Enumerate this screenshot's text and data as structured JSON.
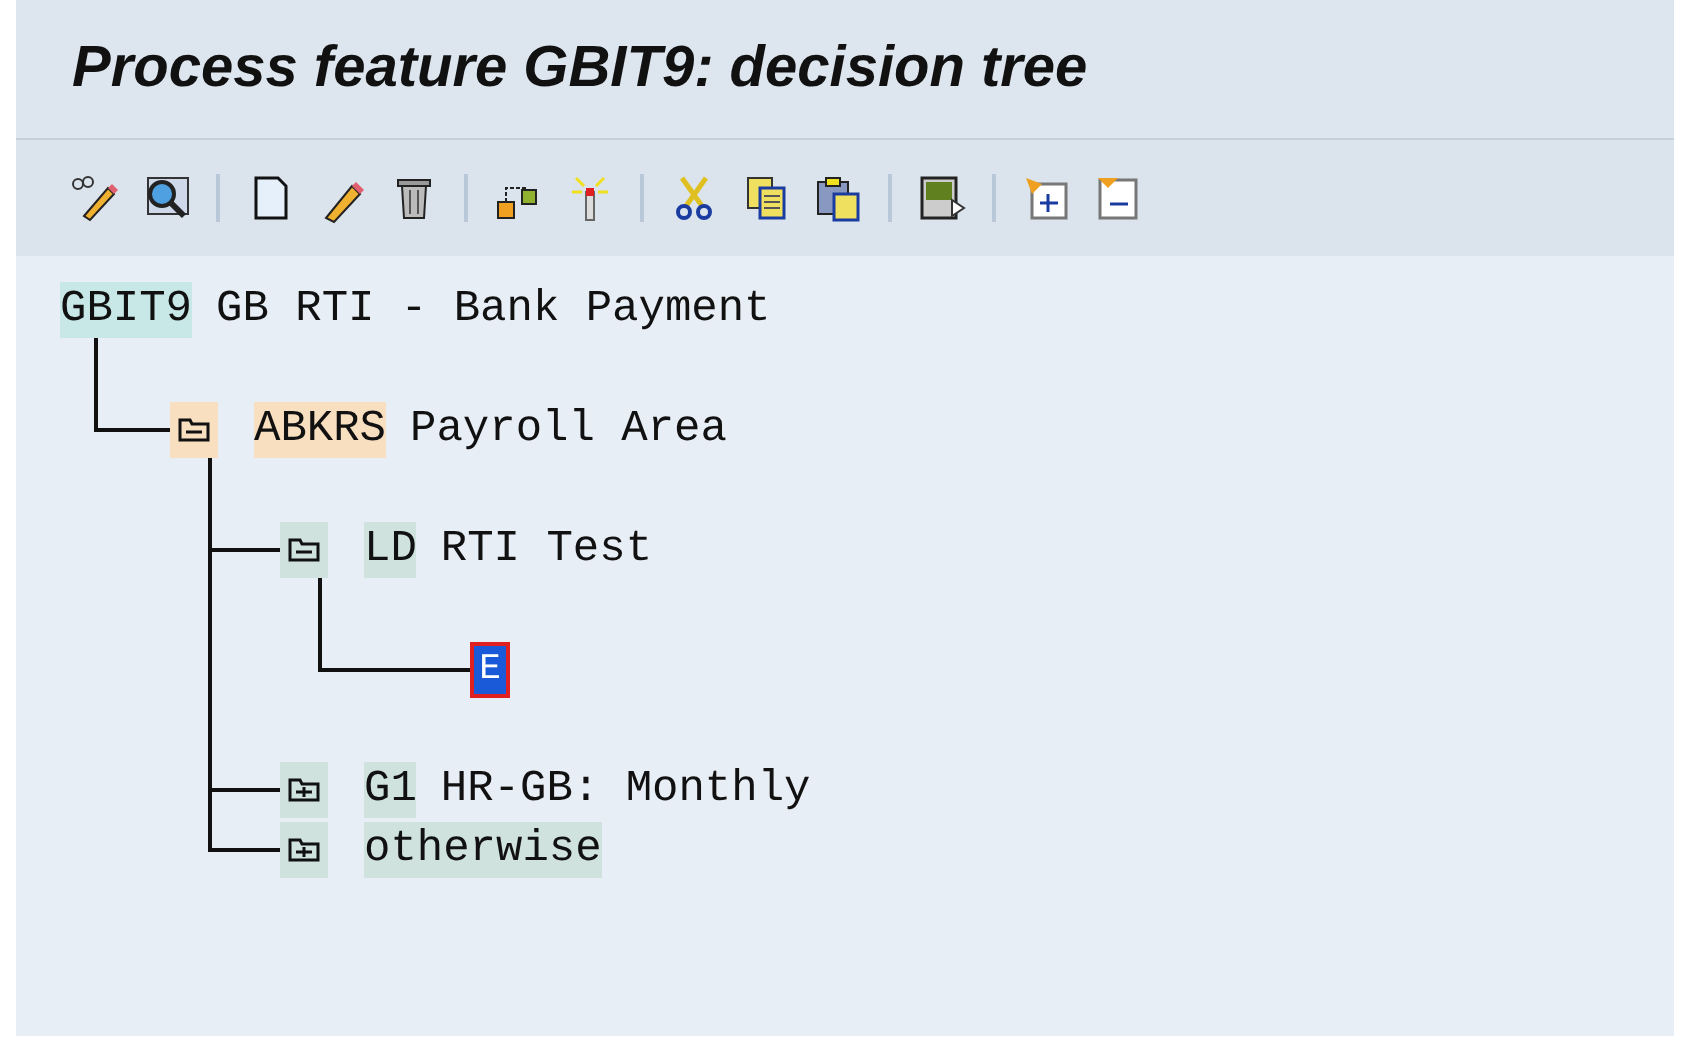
{
  "window": {
    "title": "Process feature GBIT9: decision tree"
  },
  "tree": {
    "kind": "root",
    "key": "GBIT9",
    "text": "GB RTI - Bank Payment",
    "children": [
      {
        "kind": "node",
        "key": "ABKRS",
        "text": "Payroll Area",
        "selected": true,
        "expanded": true,
        "children": [
          {
            "kind": "node",
            "key": "LD",
            "text": "RTI Test",
            "selected": false,
            "expanded": true,
            "children": [
              {
                "kind": "leaf",
                "key": "E"
              }
            ]
          },
          {
            "kind": "node",
            "key": "G1",
            "text": "HR-GB: Monthly",
            "selected": false,
            "expanded": false
          },
          {
            "kind": "node",
            "key": "otherwise",
            "selected": false,
            "expanded": false
          }
        ]
      }
    ]
  }
}
